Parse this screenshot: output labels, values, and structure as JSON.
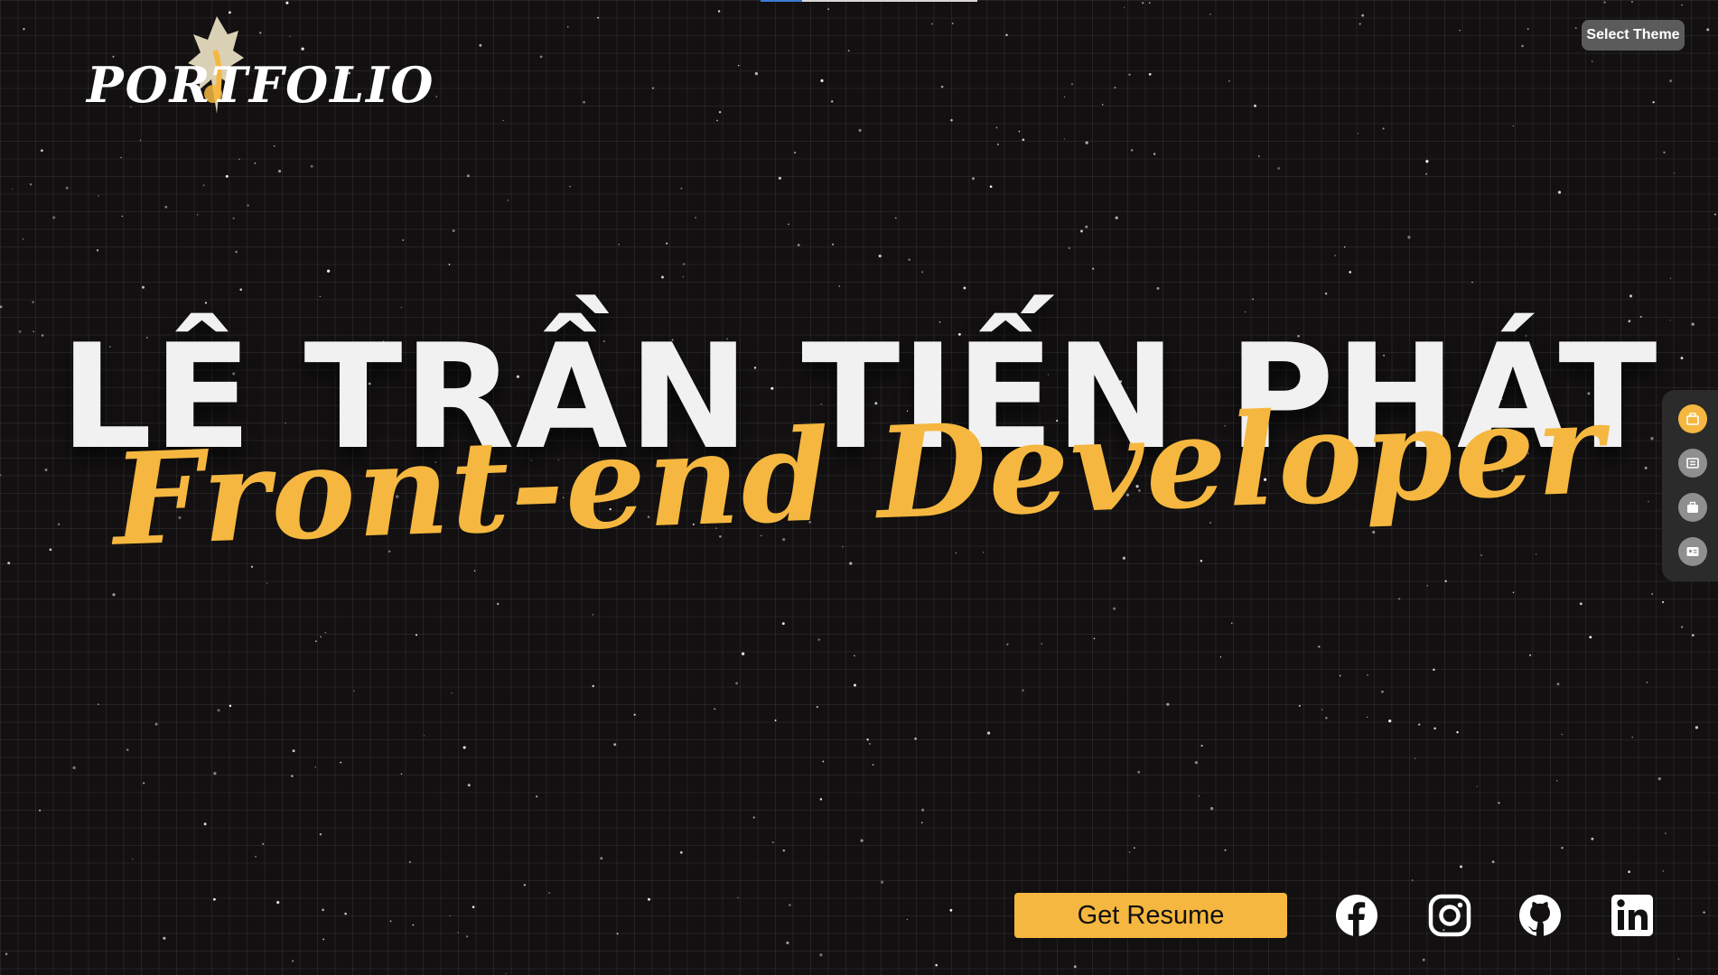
{
  "logo": {
    "text": "PORTFOLIO"
  },
  "header": {
    "theme_button_label": "Select Theme"
  },
  "hero": {
    "name": "LÊ TRẦN TIẾN PHÁT",
    "role": "Front-end Developer"
  },
  "side_nav": {
    "items": [
      {
        "icon": "home-icon",
        "active": true
      },
      {
        "icon": "list-icon",
        "active": false
      },
      {
        "icon": "briefcase-icon",
        "active": false
      },
      {
        "icon": "contact-card-icon",
        "active": false
      }
    ]
  },
  "actions": {
    "resume_label": "Get Resume"
  },
  "social": [
    {
      "icon": "facebook-icon"
    },
    {
      "icon": "instagram-icon"
    },
    {
      "icon": "github-icon"
    },
    {
      "icon": "linkedin-icon"
    }
  ],
  "colors": {
    "background": "#121010",
    "accent": "#f5b73f",
    "name_text": "#f1f1f1",
    "theme_button": "#5b5b5b",
    "side_nav_bg": "#2b2b2b",
    "side_nav_inactive": "#8f8f8f"
  }
}
